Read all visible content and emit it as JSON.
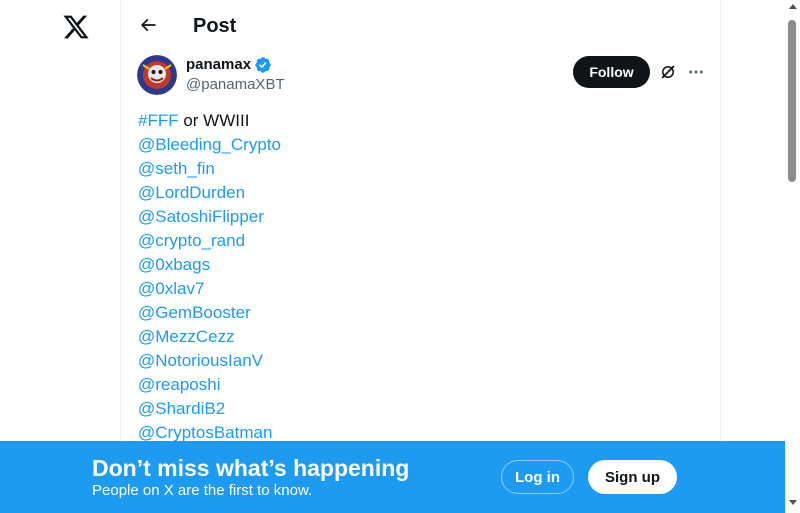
{
  "app": {
    "logo_icon": "x-logo-icon"
  },
  "header": {
    "title": "Post",
    "back_icon": "arrow-left-icon"
  },
  "author": {
    "display_name": "panamax",
    "handle": "@panamaXBT",
    "verified": true,
    "verified_color": "#1d9bf0"
  },
  "actions": {
    "follow_label": "Follow",
    "grok_icon": "grok-icon",
    "more_icon": "more-horizontal-icon"
  },
  "tweet": {
    "first_line": {
      "hashtag": "#FFF",
      "text": " or WWIII"
    },
    "mentions": [
      "@Bleeding_Crypto",
      "@seth_fin",
      "@LordDurden",
      "@SatoshiFlipper",
      "@crypto_rand",
      "@0xbags",
      "@0xlav7",
      "@GemBooster",
      "@MezzCezz",
      "@NotoriousIanV",
      "@reaposhi",
      "@ShardiB2",
      "@CryptosBatman"
    ]
  },
  "banner": {
    "title": "Don’t miss what’s happening",
    "subtitle": "People on X are the first to know.",
    "login_label": "Log in",
    "signup_label": "Sign up",
    "background": "#1d9bf0"
  },
  "colors": {
    "link": "#1d9bf0",
    "text": "#0f1419",
    "muted": "#536471"
  }
}
